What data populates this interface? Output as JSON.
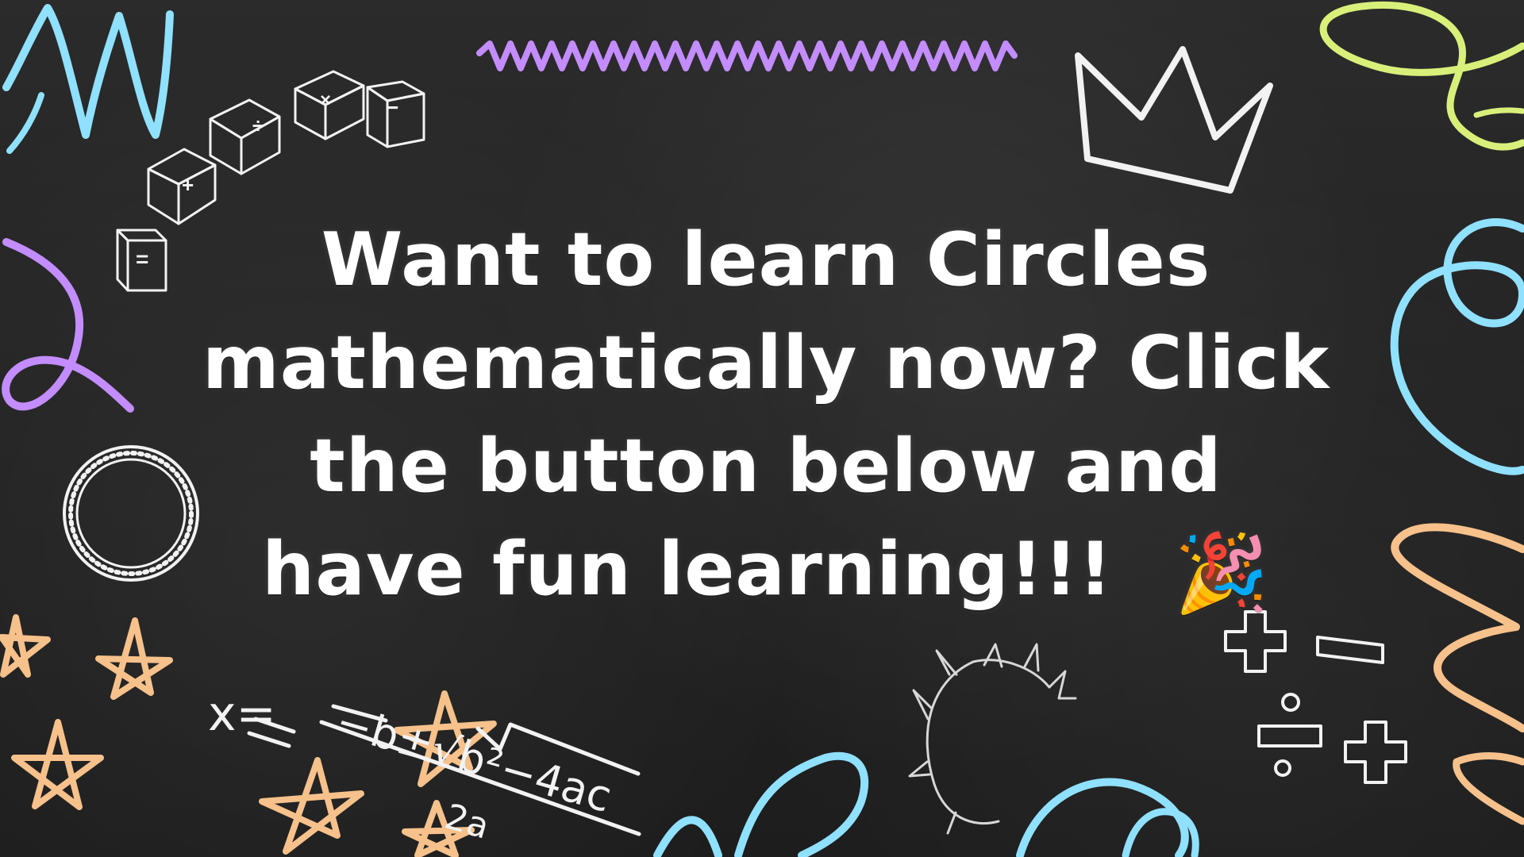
{
  "slide": {
    "background_color": "#262626",
    "chalk_colors": {
      "blue": "#8fe1ff",
      "purple": "#c38cff",
      "green": "#d8f07a",
      "orange": "#f7c18b",
      "white": "#f2f2f2"
    },
    "headline_lines": [
      "Want to learn Circles",
      "mathematically now? Click",
      "the button below and",
      "have fun learning!!!"
    ],
    "party_icon": "🎉",
    "formula": {
      "lhs": "x=",
      "numerator": "−b±√b²−4ac",
      "denominator": "2a"
    }
  }
}
